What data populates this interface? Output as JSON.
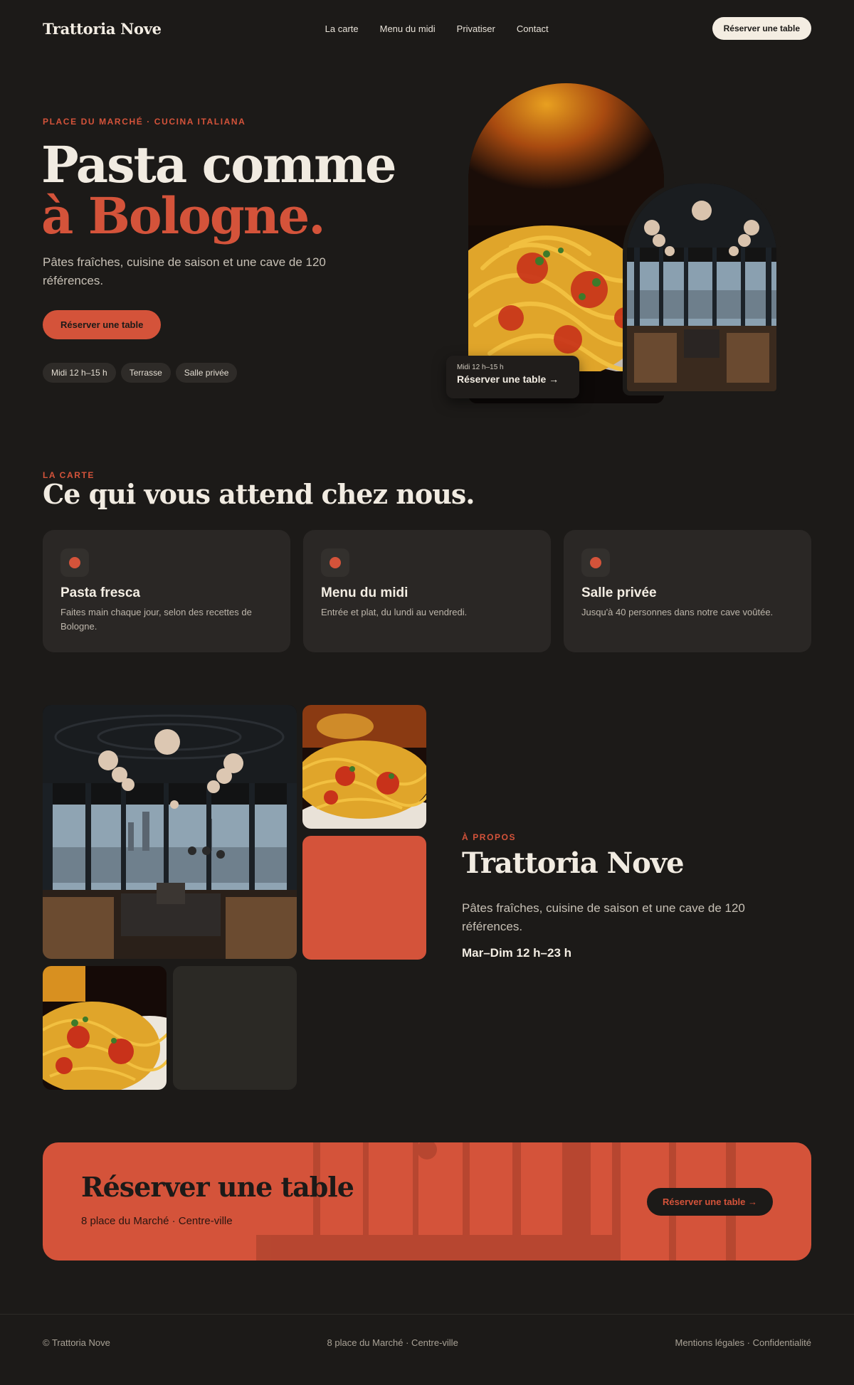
{
  "nav": {
    "logo": "Trattoria Nove",
    "links": [
      "La carte",
      "Menu du midi",
      "Privatiser",
      "Contact"
    ],
    "cta": "Réserver une table"
  },
  "hero": {
    "eyebrow": "PLACE DU MARCHÉ · CUCINA ITALIANA",
    "title_line1": "Pasta comme",
    "title_line2": "à Bologne.",
    "subtitle": "Pâtes fraîches, cuisine de saison et une cave de 120 références.",
    "cta": "Réserver une table",
    "chips": [
      "Midi 12 h–15 h",
      "Terrasse",
      "Salle privée"
    ],
    "card_small": "Midi 12 h–15 h",
    "card_big": "Réserver une table →"
  },
  "carte": {
    "eyebrow": "LA CARTE",
    "title": "Ce qui vous attend chez nous.",
    "cards": [
      {
        "title": "Pasta fresca",
        "text": "Faites main chaque jour, selon des recettes de Bologne."
      },
      {
        "title": "Menu du midi",
        "text": "Entrée et plat, du lundi au vendredi."
      },
      {
        "title": "Salle privée",
        "text": "Jusqu'à 40 personnes dans notre cave voûtée."
      }
    ]
  },
  "about": {
    "eyebrow": "À PROPOS",
    "title": "Trattoria Nove",
    "subtitle": "Pâtes fraîches, cuisine de saison et une cave de 120 références.",
    "hours": "Mar–Dim 12 h–23 h"
  },
  "cta": {
    "title": "Réserver une table",
    "subtitle": "8 place du Marché · Centre-ville",
    "button": "Réserver une table →"
  },
  "footer": {
    "copyright": "© Trattoria Nove",
    "address": "8 place du Marché · Centre-ville",
    "legal": "Mentions légales · Confidentialité"
  },
  "colors": {
    "background": "#1c1a18",
    "accent": "#d4533a",
    "card": "#2a2725",
    "text": "#f1ebe1"
  }
}
